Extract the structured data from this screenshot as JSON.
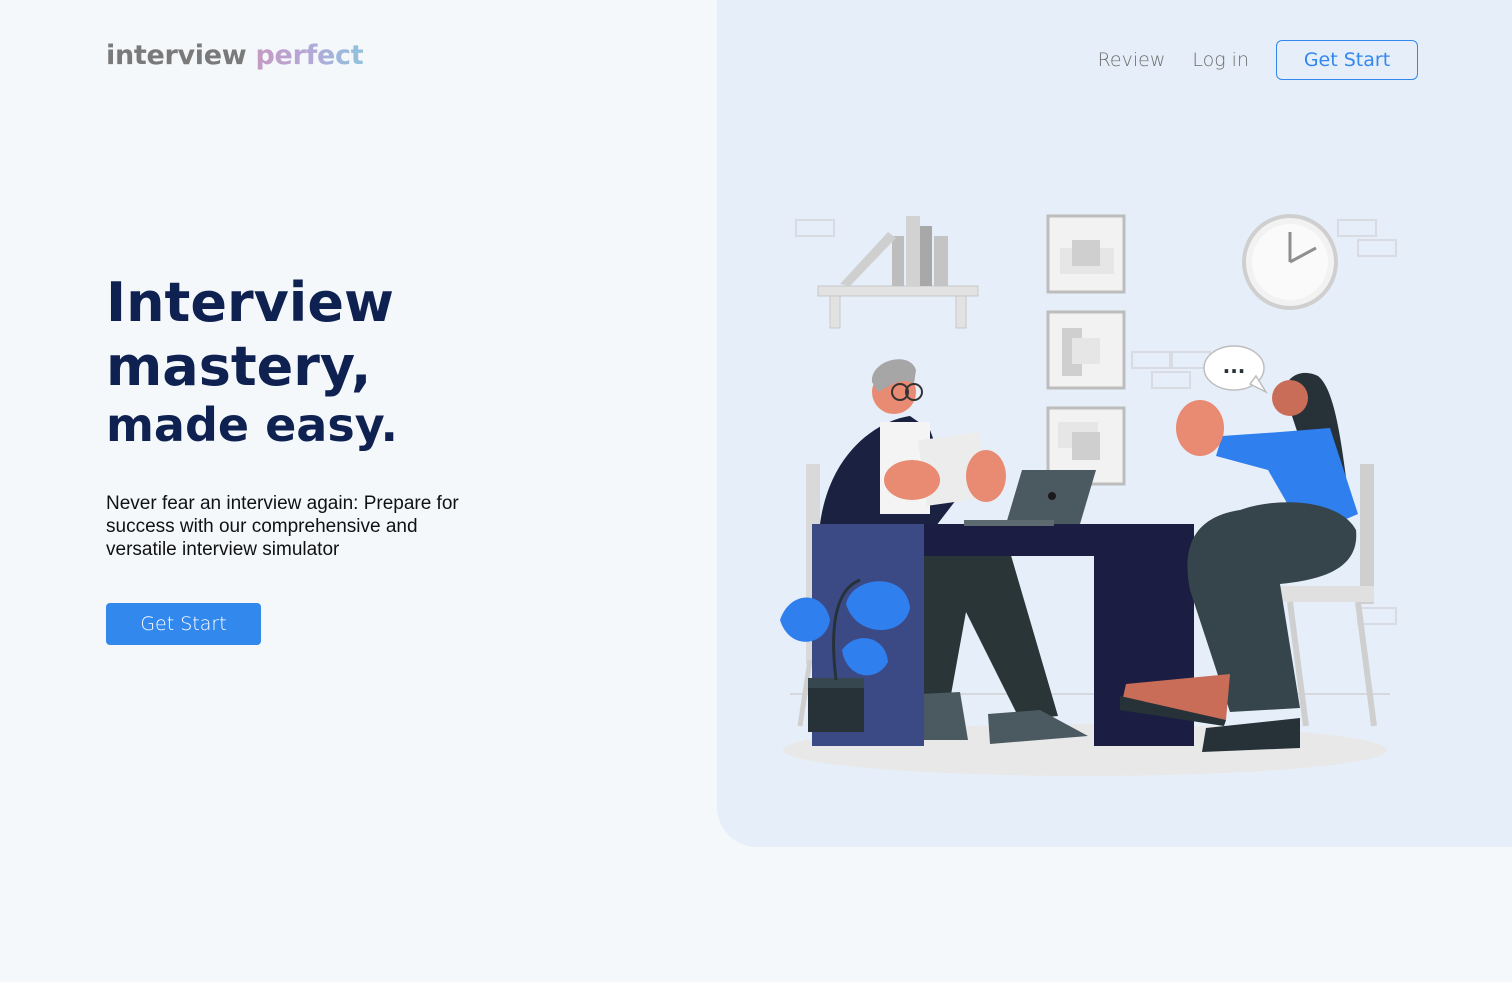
{
  "brand": {
    "word1": "interview",
    "word2": "perfect"
  },
  "nav": {
    "review": "Review",
    "login": "Log in",
    "get_start": "Get Start"
  },
  "hero": {
    "line1": "Interview",
    "line2": "mastery,",
    "line3": "made easy.",
    "description": "Never fear an interview again: Prepare for success with our comprehensive and versatile interview simulator",
    "cta": "Get Start"
  },
  "speech_bubble": "..."
}
